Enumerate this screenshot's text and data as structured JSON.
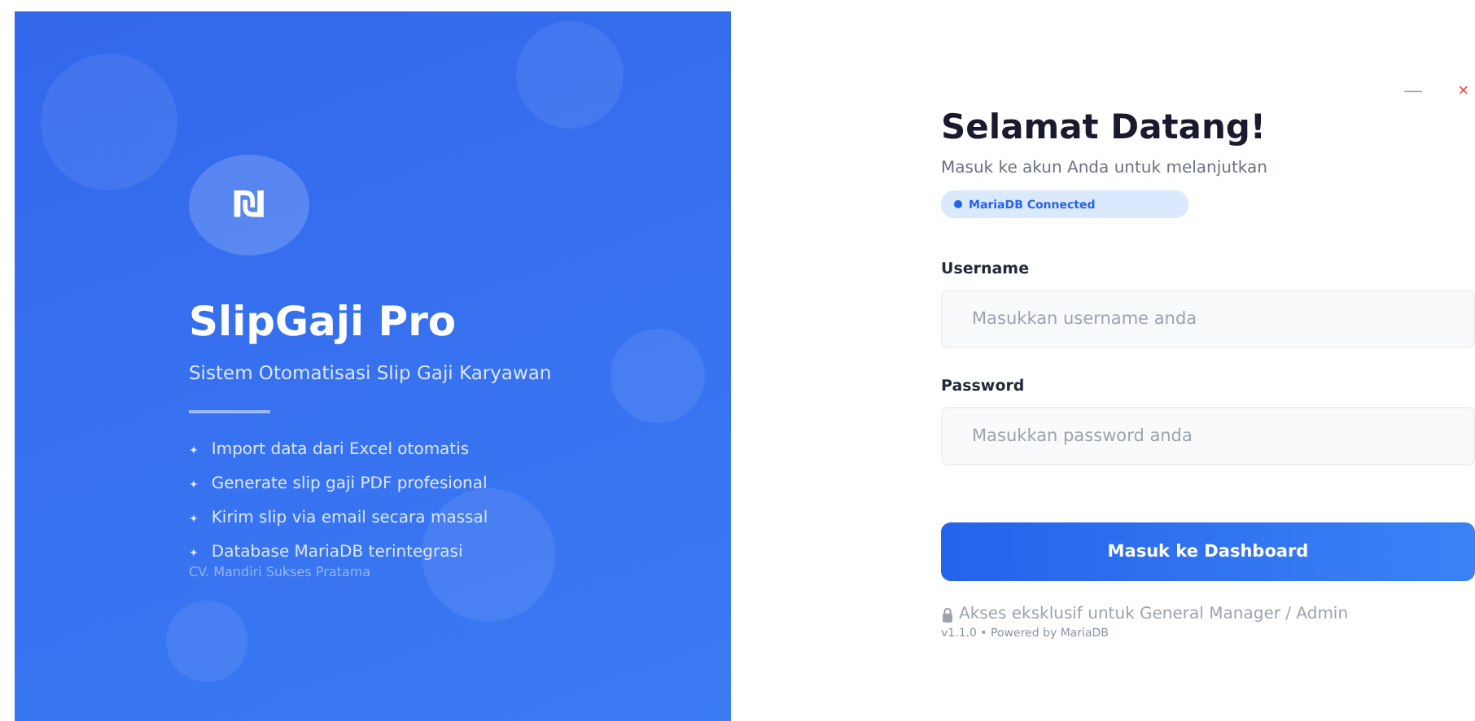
{
  "brand": {
    "logo": "₪",
    "name": "SlipGaji Pro",
    "tagline": "Sistem Otomatisasi Slip Gaji Karyawan",
    "features": [
      {
        "bullet": "✦",
        "text": "Import data dari Excel otomatis"
      },
      {
        "bullet": "✦",
        "text": "Generate slip gaji PDF profesional"
      },
      {
        "bullet": "✦",
        "text": "Kirim slip via email secara massal"
      },
      {
        "bullet": "✦",
        "text": "Database MariaDB terintegrasi"
      }
    ],
    "company": "CV. Mandiri Sukses Pratama"
  },
  "window_controls": {
    "minimize": "—",
    "close": "×"
  },
  "login": {
    "title": "Selamat Datang!",
    "subtitle": "Masuk ke akun Anda untuk melanjutkan",
    "status": {
      "text": "MariaDB Connected",
      "color": "#2563eb"
    },
    "fields": [
      {
        "label": "Username",
        "placeholder": "Masukkan username anda"
      },
      {
        "label": "Password",
        "placeholder": "Masukkan password anda"
      }
    ],
    "button": "Masuk ke Dashboard",
    "note": "Akses eksklusif untuk General Manager / Admin",
    "version": "v1.1.0 • Powered by MariaDB"
  }
}
